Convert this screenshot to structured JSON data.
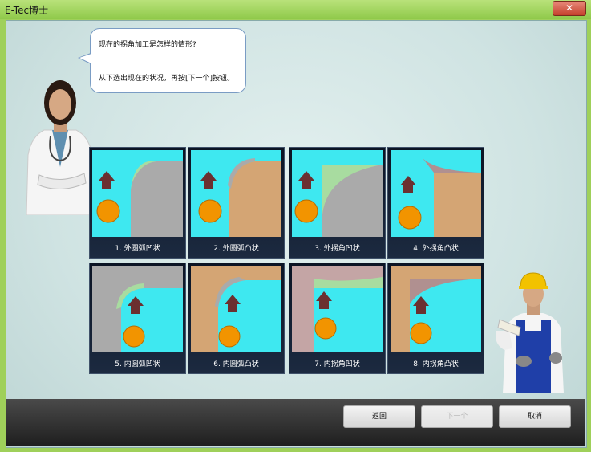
{
  "window": {
    "title": "E-Tec博士",
    "close_glyph": "✕"
  },
  "bubble": {
    "line1": "现在的拐角加工是怎样的情形?",
    "line2": "从下选出现在的状况，再按[下一个]按钮。"
  },
  "options": [
    {
      "label": "1. 外圆弧凹状"
    },
    {
      "label": "2. 外圆弧凸状"
    },
    {
      "label": "3. 外拐角凹状"
    },
    {
      "label": "4. 外拐角凸状"
    },
    {
      "label": "5. 内圆弧凹状"
    },
    {
      "label": "6. 内圆弧凸状"
    },
    {
      "label": "7. 内拐角凹状"
    },
    {
      "label": "8. 内拐角凸状"
    }
  ],
  "buttons": {
    "back": "返回",
    "next": "下一个",
    "cancel": "取消"
  },
  "colors": {
    "cyan": "#3ee8f0",
    "gray_part": "#aaaaaa",
    "tan_part": "#d4a574",
    "pink_part": "#c4a5a5",
    "tool": "#f29400",
    "arrow": "#6b3030"
  }
}
